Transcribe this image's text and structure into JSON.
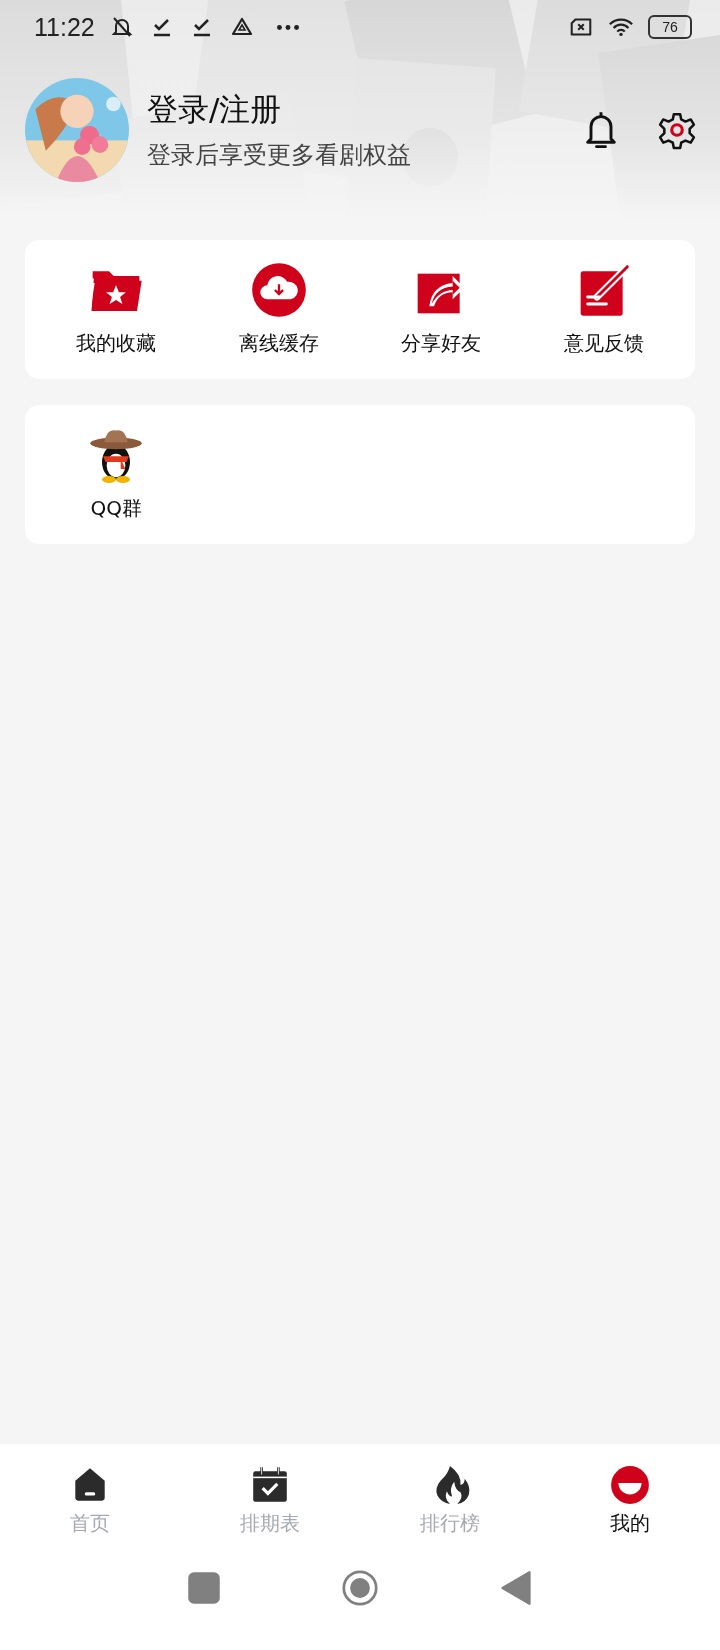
{
  "status_bar": {
    "time": "11:22",
    "battery": "76"
  },
  "profile": {
    "title": "登录/注册",
    "subtitle": "登录后享受更多看剧权益"
  },
  "shortcuts": [
    {
      "kind": "favorites",
      "label": "我的收藏"
    },
    {
      "kind": "download",
      "label": "离线缓存"
    },
    {
      "kind": "share",
      "label": "分享好友"
    },
    {
      "kind": "feedback",
      "label": "意见反馈"
    }
  ],
  "groups": [
    {
      "kind": "qq",
      "label": "QQ群"
    }
  ],
  "bottom_nav": [
    {
      "kind": "home",
      "label": "首页",
      "selected": false
    },
    {
      "kind": "schedule",
      "label": "排期表",
      "selected": false
    },
    {
      "kind": "ranking",
      "label": "排行榜",
      "selected": false
    },
    {
      "kind": "me",
      "label": "我的",
      "selected": true
    }
  ]
}
